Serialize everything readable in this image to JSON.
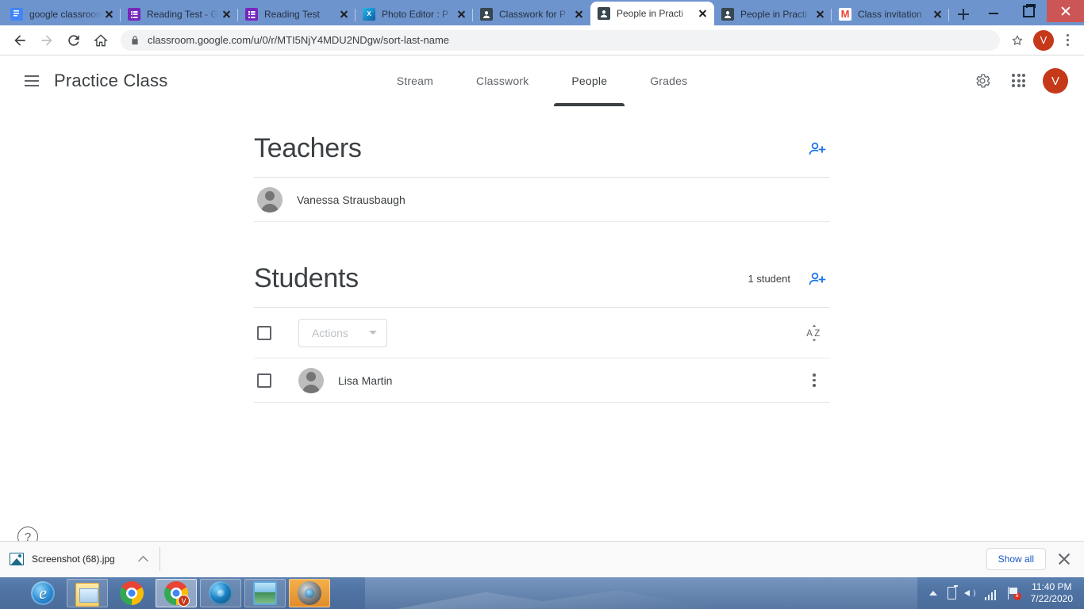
{
  "browser": {
    "tabs": [
      {
        "title": "google classroom",
        "favicon": "docs-icon",
        "active": false
      },
      {
        "title": "Reading Test - G",
        "favicon": "forms-icon",
        "active": false
      },
      {
        "title": "Reading Test",
        "favicon": "forms-icon",
        "active": false
      },
      {
        "title": "Photo Editor : P",
        "favicon": "photo-editor-icon",
        "active": false
      },
      {
        "title": "Classwork for P",
        "favicon": "classroom-icon",
        "active": false
      },
      {
        "title": "People in Practi",
        "favicon": "classroom-icon",
        "active": true
      },
      {
        "title": "People in Practi",
        "favicon": "classroom-icon",
        "active": false
      },
      {
        "title": "Class invitation",
        "favicon": "gmail-icon",
        "active": false
      }
    ],
    "new_tab_label": "New tab",
    "url": "classroom.google.com/u/0/r/MTI5NjY4MDU2NDgw/sort-last-name",
    "profile_initial": "V",
    "window_controls": {
      "minimize": "Minimize",
      "maximize": "Restore",
      "close": "Close"
    }
  },
  "classroom": {
    "class_title": "Practice Class",
    "tabs": [
      {
        "label": "Stream",
        "active": false
      },
      {
        "label": "Classwork",
        "active": false
      },
      {
        "label": "People",
        "active": true
      },
      {
        "label": "Grades",
        "active": false
      }
    ],
    "avatar_initial": "V",
    "teachers": {
      "heading": "Teachers",
      "invite_label": "Invite teachers",
      "people": [
        {
          "name": "Vanessa Strausbaugh"
        }
      ]
    },
    "students": {
      "heading": "Students",
      "count_label": "1 student",
      "invite_label": "Invite students",
      "sort_label": "Sort by last name",
      "actions_label": "Actions",
      "people": [
        {
          "name": "Lisa Martin"
        }
      ]
    },
    "help_label": "?"
  },
  "download_shelf": {
    "file_name": "Screenshot (68).jpg",
    "show_all_label": "Show all",
    "close_label": "Close"
  },
  "taskbar": {
    "apps": [
      {
        "name": "internet-explorer"
      },
      {
        "name": "file-explorer"
      },
      {
        "name": "google-chrome"
      },
      {
        "name": "google-chrome-active",
        "badge": "V"
      },
      {
        "name": "media-player"
      },
      {
        "name": "photo-viewer"
      },
      {
        "name": "photo-editor"
      }
    ],
    "time": "11:40 PM",
    "date": "7/22/2020"
  },
  "colors": {
    "accent_blue": "#1a73e8",
    "chrome_frame": "#6e94ce",
    "avatar_red": "#c5391a",
    "active_tab_underline": "#3c4043"
  }
}
